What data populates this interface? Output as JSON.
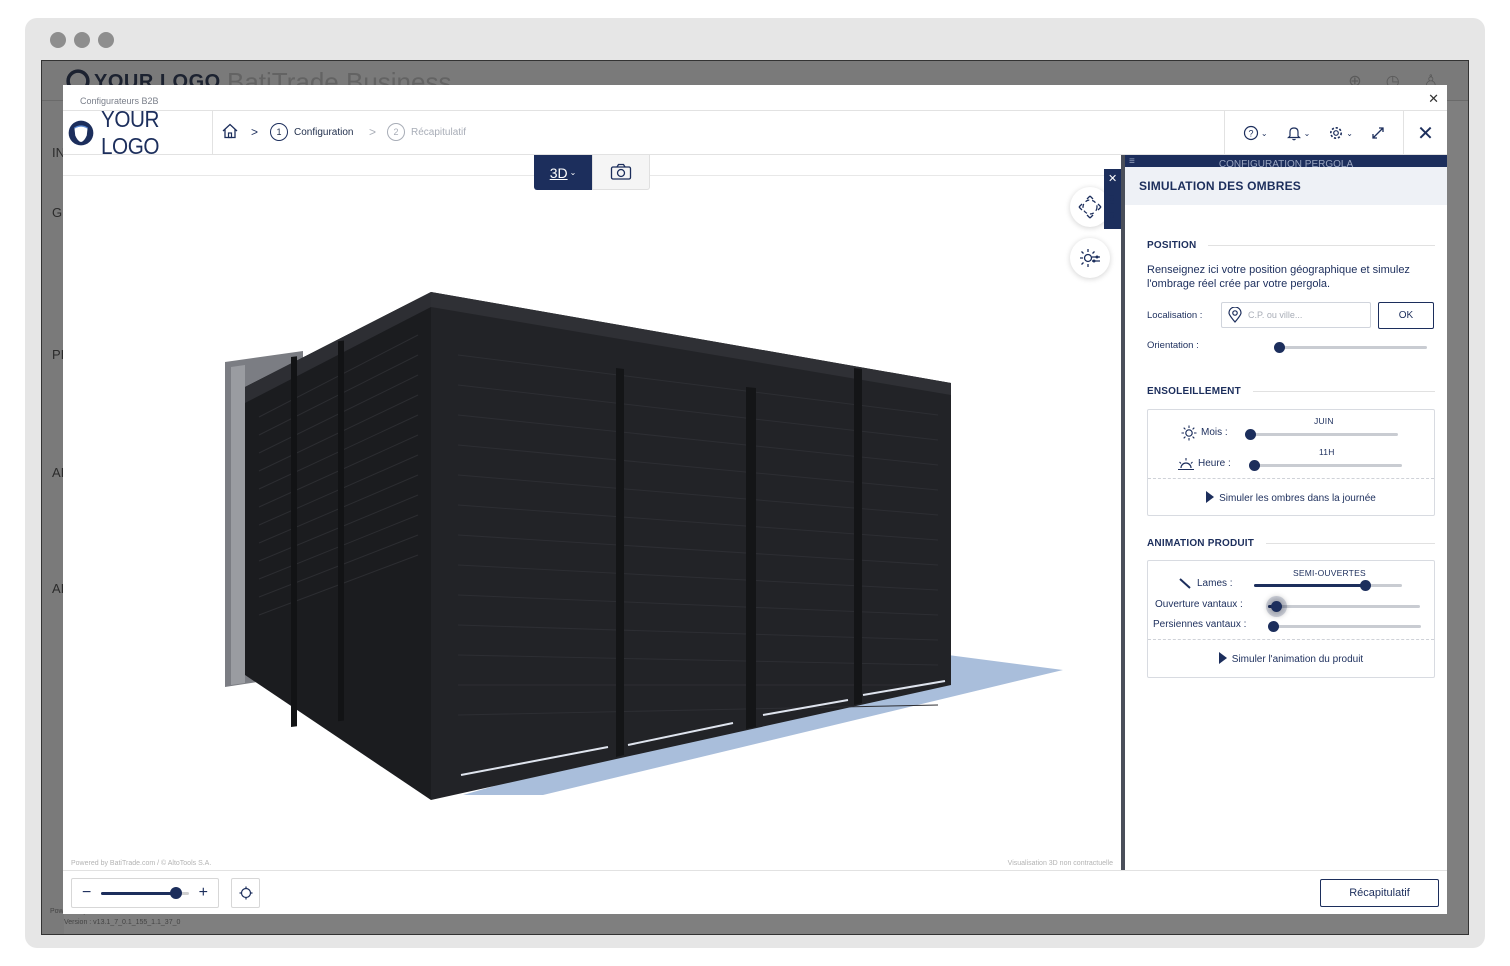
{
  "background_app": {
    "logo": "YOUR LOGO",
    "title": "BatiTrade Business",
    "footer_powered": "Powered by BatiTrade.com / © AltoTools S.A.",
    "footer_version": "Version : v13.1_7_0.1_155_1.1_37_0",
    "side_letters": [
      "IN",
      "GI",
      "PI",
      "AI",
      "AI"
    ]
  },
  "modal": {
    "title": "Configurateurs B2B",
    "logo_text": "YOUR LOGO",
    "breadcrumb": {
      "home_icon": "home-icon",
      "steps": [
        {
          "num": "1",
          "label": "Configuration",
          "active": true
        },
        {
          "num": "2",
          "label": "Récapitulatif",
          "active": false
        }
      ]
    },
    "toolbar_icons": [
      "help-icon",
      "bell-icon",
      "gear-icon",
      "expand-icon"
    ]
  },
  "viewer": {
    "mode_3d_label": "3D",
    "credit_left": "Powered by BatiTrade.com / © AltoTools S.A.",
    "credit_right": "Visualisation 3D non contractuelle",
    "fermer_label": "Fermer",
    "zoom_level": 0.85
  },
  "panel": {
    "header": "CONFIGURATION PERGOLA",
    "subheader": "SIMULATION DES OMBRES",
    "position": {
      "title": "POSITION",
      "description": "Renseignez ici votre position géographique et simulez l'ombrage réel crée par votre pergola.",
      "location_label": "Localisation :",
      "location_placeholder": "C.P. ou ville...",
      "ok_label": "OK",
      "orientation_label": "Orientation :",
      "orientation_value": 0.0
    },
    "ensoleillement": {
      "title": "ENSOLEILLEMENT",
      "mois_label": "Mois :",
      "mois_value_label": "JUIN",
      "mois_value": 0.0,
      "heure_label": "Heure :",
      "heure_value_label": "11H",
      "heure_value": 0.0,
      "simulate_label": "Simuler les ombres dans la journée"
    },
    "animation": {
      "title": "ANIMATION PRODUIT",
      "lames_label": "Lames :",
      "lames_value_label": "SEMI-OUVERTES",
      "lames_value": 0.75,
      "ouverture_label": "Ouverture vantaux :",
      "ouverture_value": 0.05,
      "persiennes_label": "Persiennes vantaux :",
      "persiennes_value": 0.0,
      "simulate_label": "Simuler l'animation du produit"
    }
  },
  "bottom": {
    "recap_label": "Récapitulatif"
  },
  "colors": {
    "primary": "#1c2e5c",
    "shadow": "#a9bedb",
    "pergola": "#26272b"
  }
}
